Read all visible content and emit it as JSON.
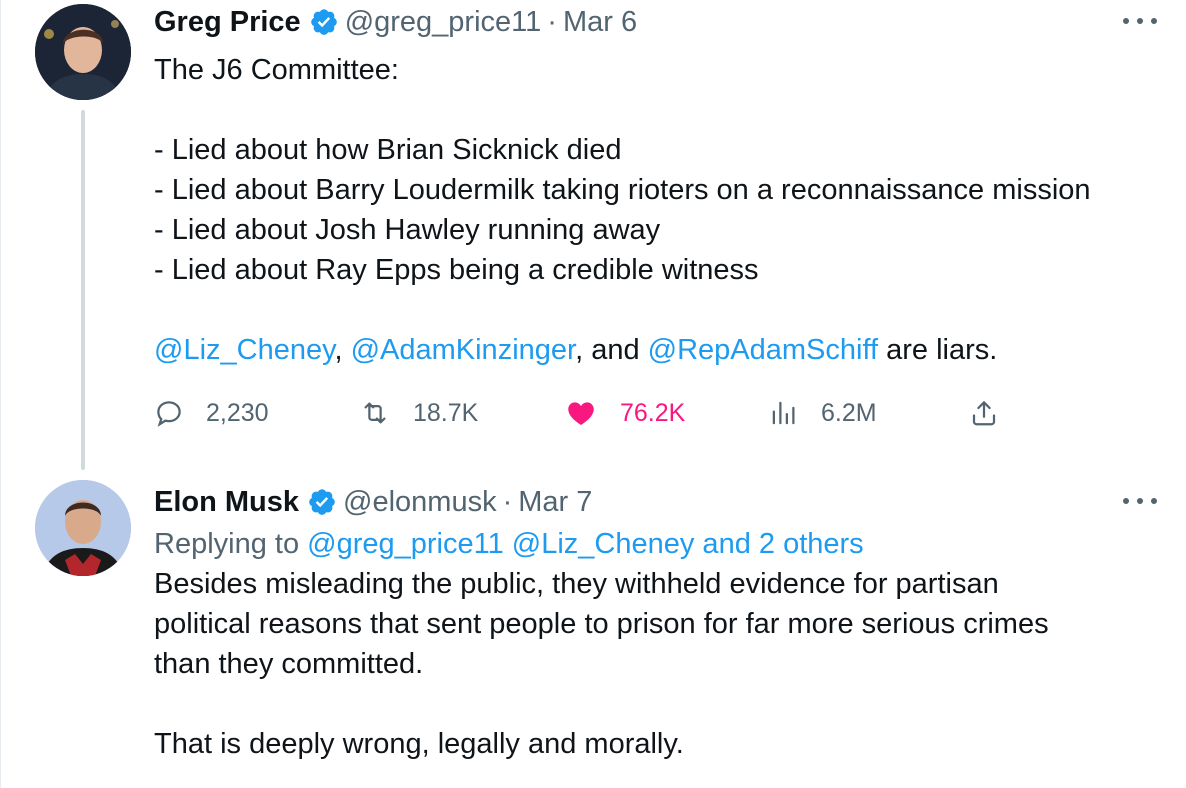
{
  "tweets": [
    {
      "author": "Greg Price",
      "handle": "@greg_price11",
      "separator": "·",
      "date": "Mar 6",
      "text_lines": [
        "The J6 Committee:",
        "",
        "- Lied about how Brian Sicknick died",
        "- Lied about Barry Loudermilk taking rioters on a reconnaissance mission",
        "- Lied about Josh Hawley running away",
        "- Lied about Ray Epps being a credible witness",
        ""
      ],
      "mentions_line": {
        "mention1": "@Liz_Cheney",
        "sep1": ", ",
        "mention2": "@AdamKinzinger",
        "sep2": ", and ",
        "mention3": "@RepAdamSchiff",
        "tail": " are liars."
      },
      "stats": {
        "replies": "2,230",
        "retweets": "18.7K",
        "likes": "76.2K",
        "views": "6.2M"
      },
      "icons": [
        "reply-icon",
        "retweet-icon",
        "heart-icon",
        "views-icon",
        "share-icon"
      ]
    },
    {
      "author": "Elon Musk",
      "handle": "@elonmusk",
      "separator": "·",
      "date": "Mar 7",
      "replying": {
        "prefix": "Replying to ",
        "targets": "@greg_price11 @Liz_Cheney and 2 others"
      },
      "text": "Besides misleading the public, they withheld evidence for partisan\npolitical reasons that sent people to prison for far more serious crimes\nthan they committed.\n\nThat is deeply wrong, legally and morally."
    }
  ],
  "colors": {
    "link": "#1d9bf0",
    "like": "#f91880",
    "muted": "#536471",
    "text": "#0f1419",
    "verified": "#1d9bf0"
  }
}
